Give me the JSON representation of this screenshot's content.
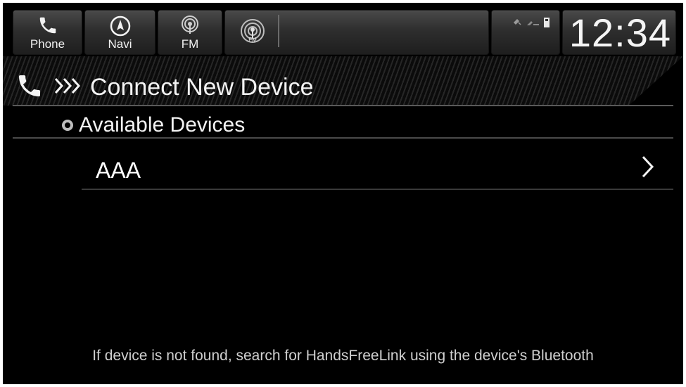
{
  "topbar": {
    "phone_label": "Phone",
    "navi_label": "Navi",
    "fm_label": "FM",
    "fm_icon_text": "FM",
    "fm2_icon_text": "FM",
    "clock": "12:34"
  },
  "header": {
    "title": "Connect New Device"
  },
  "section": {
    "title": "Available Devices"
  },
  "devices": [
    {
      "name": "AAA"
    }
  ],
  "footer": {
    "hint": "If device is not found, search for HandsFreeLink using the device's Bluetooth"
  }
}
